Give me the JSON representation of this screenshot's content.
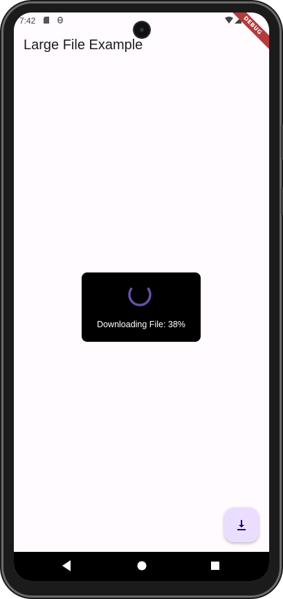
{
  "status_bar": {
    "time": "7:42",
    "icons": [
      "sd-card-icon",
      "usb-debug-icon",
      "wifi-icon",
      "signal-icon",
      "battery-icon"
    ]
  },
  "debug_banner": "DEBUG",
  "app_bar": {
    "title": "Large File Example"
  },
  "download_dialog": {
    "message": "Downloading File: 38%",
    "progress_percent": 38
  },
  "fab": {
    "icon": "download-icon"
  },
  "nav_bar": {
    "buttons": [
      "back-icon",
      "home-icon",
      "recents-icon"
    ]
  },
  "colors": {
    "accent": "#6750a4",
    "fab_background": "#eaddff",
    "dialog_background": "#000000"
  }
}
